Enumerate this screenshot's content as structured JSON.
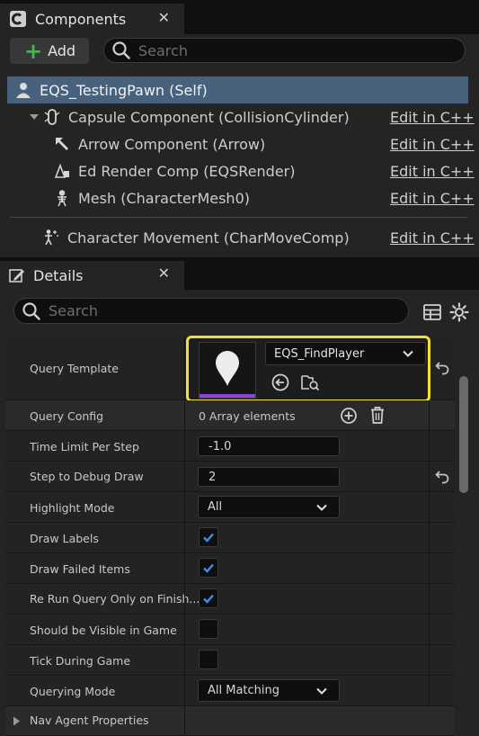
{
  "components_panel": {
    "title": "Components",
    "add_label": "Add",
    "search_placeholder": "Search",
    "root": {
      "label": "EQS_TestingPawn (Self)",
      "icon": "pawn-icon"
    },
    "tree": [
      {
        "label": "Capsule Component (CollisionCylinder)",
        "icon": "capsule-icon",
        "edit": "Edit in C++",
        "expanded": true
      },
      {
        "label": "Arrow Component (Arrow)",
        "icon": "arrow-icon",
        "edit": "Edit in C++"
      },
      {
        "label": "Ed Render Comp (EQSRender)",
        "icon": "render-icon",
        "edit": "Edit in C++"
      },
      {
        "label": "Mesh (CharacterMesh0)",
        "icon": "skeleton-icon",
        "edit": "Edit in C++"
      }
    ],
    "movement": {
      "label": "Character Movement (CharMoveComp)",
      "icon": "movement-icon",
      "edit": "Edit in C++"
    }
  },
  "details_panel": {
    "title": "Details",
    "search_placeholder": "Search",
    "properties": {
      "query_template": {
        "label": "Query Template",
        "value": "EQS_FindPlayer"
      },
      "query_config": {
        "label": "Query Config",
        "value": "0 Array elements"
      },
      "time_limit": {
        "label": "Time Limit Per Step",
        "value": "-1.0"
      },
      "step_debug": {
        "label": "Step to Debug Draw",
        "value": "2"
      },
      "highlight_mode": {
        "label": "Highlight Mode",
        "value": "All"
      },
      "draw_labels": {
        "label": "Draw Labels",
        "checked": true
      },
      "draw_failed": {
        "label": "Draw Failed Items",
        "checked": true
      },
      "rerun_query": {
        "label": "Re Run Query Only on Finish...",
        "checked": true
      },
      "visible_in_game": {
        "label": "Should be Visible in Game",
        "checked": false
      },
      "tick_during_game": {
        "label": "Tick During Game",
        "checked": false
      },
      "querying_mode": {
        "label": "Querying Mode",
        "value": "All Matching"
      },
      "nav_agent": {
        "label": "Nav Agent Properties"
      }
    }
  },
  "colors": {
    "selection": "#48617d",
    "highlight_border": "#f2df2e",
    "check": "#3d8fe8",
    "add_green": "#4db050",
    "thumb_accent": "#8a44d8"
  }
}
